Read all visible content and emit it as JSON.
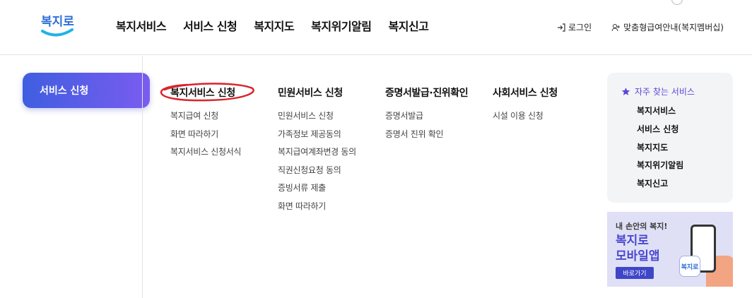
{
  "header": {
    "logo_text": "복지로",
    "gnb": [
      "복지서비스",
      "서비스 신청",
      "복지지도",
      "복지위기알림",
      "복지신고"
    ],
    "login": "로그인",
    "member": "맞춤형급여안내(복지멤버십)"
  },
  "panel": {
    "category_button": "서비스 신청",
    "columns": [
      {
        "title": "복지서비스 신청",
        "items": [
          "복지급여 신청",
          "화면 따라하기",
          "복지서비스 신청서식"
        ]
      },
      {
        "title": "민원서비스 신청",
        "items": [
          "민원서비스 신청",
          "가족정보 제공동의",
          "복지급여계좌변경 동의",
          "직권신청요청 동의",
          "증빙서류 제출",
          "화면 따라하기"
        ]
      },
      {
        "title": "증명서발급·진위확인",
        "items": [
          "증명서발급",
          "증명서 진위 확인"
        ]
      },
      {
        "title": "사회서비스 신청",
        "items": [
          "시설 이용 신청"
        ]
      }
    ],
    "favorites": {
      "title": "자주 찾는 서비스",
      "items": [
        "복지서비스",
        "서비스 신청",
        "복지지도",
        "복지위기알림",
        "복지신고"
      ]
    },
    "banner": {
      "line1": "내 손안의 복지!",
      "line2a": "복지로",
      "line2b": "모바일앱",
      "button": "바로가기",
      "app_label": "복지로"
    }
  },
  "colors": {
    "accent": "#5a48d8",
    "button_gradient_start": "#3f5ee0",
    "button_gradient_end": "#7a5cf0",
    "highlight_circle": "#d9232a"
  }
}
